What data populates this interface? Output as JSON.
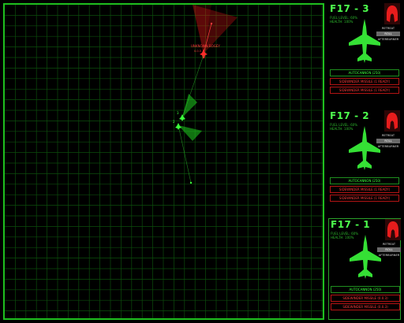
{
  "enemy": {
    "label": "UNKNOWN BOGEY",
    "sublabel": "0.0.3"
  },
  "friendlies": [
    {
      "label": "3"
    },
    {
      "label": "2"
    }
  ],
  "squadron": [
    {
      "name": "F17 - 3",
      "fuel": "FUEL LEVEL: 60%",
      "health": "HEALTH: 100%",
      "buttons": [
        "RETREAT",
        "ROLL",
        "AFTERBURNER"
      ],
      "weapons": [
        {
          "label": "AUTOCANNON (250)",
          "status": "ok"
        },
        {
          "label": "SIDEWINDER MISSILE (1 READY)",
          "status": "bad"
        },
        {
          "label": "SIDEWINDER MISSILE (1 READY)",
          "status": "bad"
        }
      ]
    },
    {
      "name": "F17 - 2",
      "fuel": "FUEL LEVEL: 60%",
      "health": "HEALTH: 100%",
      "buttons": [
        "RETREAT",
        "ROLL",
        "AFTERBURNER"
      ],
      "weapons": [
        {
          "label": "AUTOCANNON (250)",
          "status": "ok"
        },
        {
          "label": "SIDEWINDER MISSILE (1 READY)",
          "status": "bad"
        },
        {
          "label": "SIDEWINDER MISSILE (1 READY)",
          "status": "bad"
        }
      ]
    },
    {
      "name": "F17 - 1",
      "fuel": "FUEL LEVEL: 60%",
      "health": "HEALTH: 100%",
      "buttons": [
        "RETREAT",
        "ROLL",
        "AFTERBURNER"
      ],
      "weapons": [
        {
          "label": "AUTOCANNON (250)",
          "status": "ok"
        },
        {
          "label": "SIDEWINDER MISSILE (0.0.3)",
          "status": "bad"
        },
        {
          "label": "SIDEWINDER MISSILE (0.0.3)",
          "status": "bad"
        }
      ]
    }
  ],
  "colors": {
    "grid": "#0c4d0c",
    "friendly": "#3cff3c",
    "enemy": "#ff2a2a",
    "panel_border": "#2aa02a"
  }
}
